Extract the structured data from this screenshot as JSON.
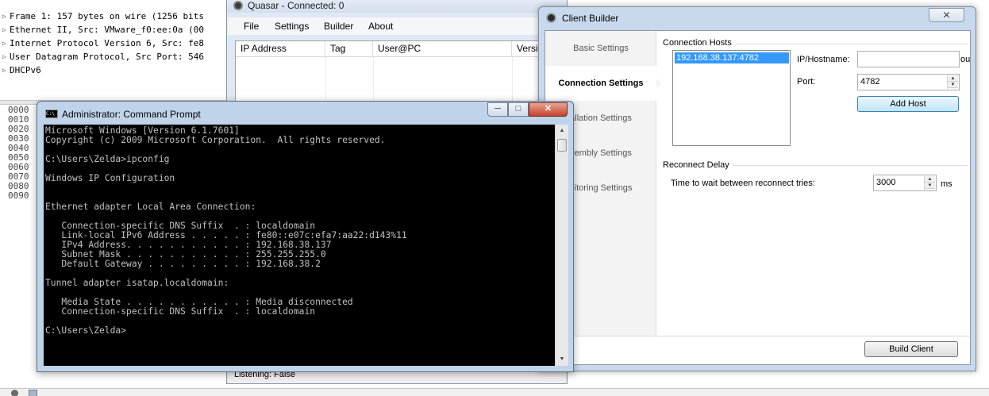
{
  "wireshark": {
    "tree": [
      "Frame 1: 157 bytes on wire (1256 bits",
      "Ethernet II, Src: VMware_f0:ee:0a (00",
      "Internet Protocol Version 6, Src: fe8",
      "User Datagram Protocol, Src Port: 546",
      "DHCPv6"
    ],
    "hex_offsets": [
      "0000",
      "0010",
      "0020",
      "0030",
      "0040",
      "0050",
      "0060",
      "0070",
      "0080",
      "0090"
    ]
  },
  "quasar": {
    "title": "Quasar - Connected: 0",
    "menu": [
      "File",
      "Settings",
      "Builder",
      "About"
    ],
    "columns": [
      "IP Address",
      "Tag",
      "User@PC",
      "Versio"
    ],
    "status": "Listening: False"
  },
  "builder": {
    "title": "Client Builder",
    "close_glyph": "✕",
    "nav": [
      "Basic Settings",
      "Connection Settings",
      "allation Settings",
      "sembly Settings",
      "nitoring Settings"
    ],
    "active_nav": "Connection Settings",
    "connection_hosts": {
      "group_title": "Connection Hosts",
      "hosts": [
        "192.168.38.137:4782"
      ],
      "ip_label": "IP/Hostname:",
      "ip_value": "",
      "port_label": "Port:",
      "port_value": "4782",
      "add_button": "Add Host",
      "hidden_suffix": "oun"
    },
    "reconnect": {
      "group_title": "Reconnect Delay",
      "label": "Time to wait between reconnect tries:",
      "value": "3000",
      "unit": "ms"
    },
    "build_button": "Build Client"
  },
  "cmd": {
    "title": "Administrator: Command Prompt",
    "icon_text": "C:\\",
    "buttons": {
      "minimize": "─",
      "maximize": "□",
      "close": "✕"
    },
    "lines": [
      "Microsoft Windows [Version 6.1.7601]",
      "Copyright (c) 2009 Microsoft Corporation.  All rights reserved.",
      "",
      "C:\\Users\\Zelda>ipconfig",
      "",
      "Windows IP Configuration",
      "",
      "",
      "Ethernet adapter Local Area Connection:",
      "",
      "   Connection-specific DNS Suffix  . : localdomain",
      "   Link-local IPv6 Address . . . . . : fe80::e07c:efa7:aa22:d143%11",
      "   IPv4 Address. . . . . . . . . . . : 192.168.38.137",
      "   Subnet Mask . . . . . . . . . . . : 255.255.255.0",
      "   Default Gateway . . . . . . . . . : 192.168.38.2",
      "",
      "Tunnel adapter isatap.localdomain:",
      "",
      "   Media State . . . . . . . . . . . : Media disconnected",
      "   Connection-specific DNS Suffix  . : localdomain",
      "",
      "C:\\Users\\Zelda>"
    ]
  }
}
